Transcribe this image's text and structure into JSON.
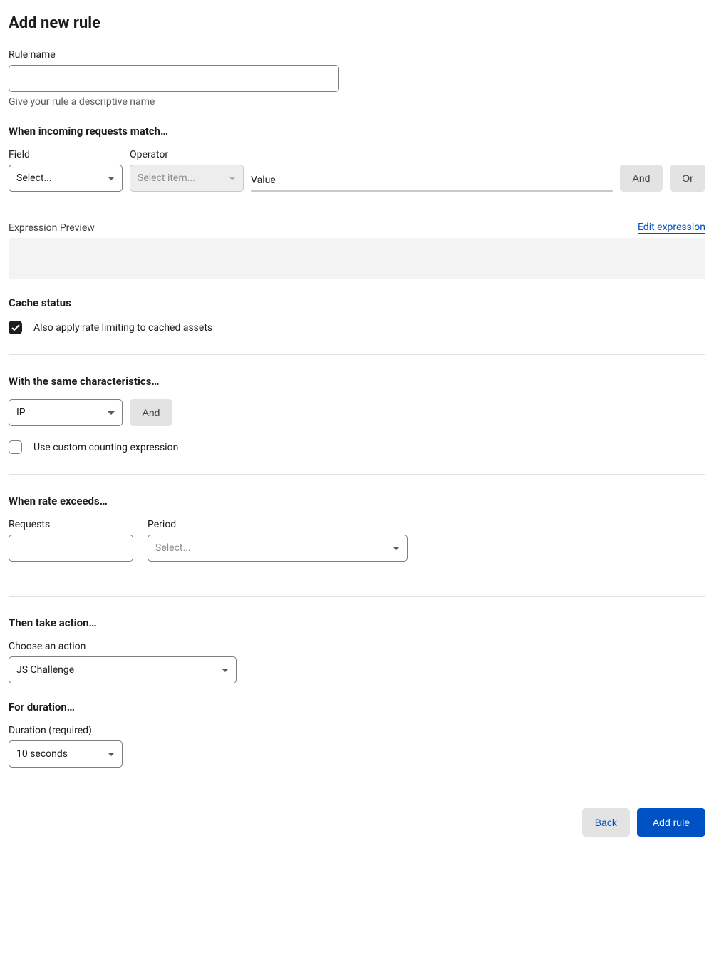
{
  "page_title": "Add new rule",
  "rule_name": {
    "label": "Rule name",
    "value": "",
    "hint": "Give your rule a descriptive name"
  },
  "match": {
    "heading": "When incoming requests match…",
    "field_label": "Field",
    "field_placeholder": "Select...",
    "operator_label": "Operator",
    "operator_placeholder": "Select item...",
    "value_label": "Value",
    "and_label": "And",
    "or_label": "Or"
  },
  "preview": {
    "title": "Expression Preview",
    "edit_link": "Edit expression"
  },
  "cache": {
    "heading": "Cache status",
    "checkbox_label": "Also apply rate limiting to cached assets",
    "checked": true
  },
  "characteristics": {
    "heading": "With the same characteristics…",
    "select_value": "IP",
    "and_label": "And",
    "custom_label": "Use custom counting expression",
    "custom_checked": false
  },
  "rate": {
    "heading": "When rate exceeds…",
    "requests_label": "Requests",
    "requests_value": "",
    "period_label": "Period",
    "period_placeholder": "Select..."
  },
  "action": {
    "heading": "Then take action…",
    "label": "Choose an action",
    "value": "JS Challenge"
  },
  "duration": {
    "heading": "For duration…",
    "label": "Duration (required)",
    "value": "10 seconds"
  },
  "footer": {
    "back": "Back",
    "add": "Add rule"
  }
}
